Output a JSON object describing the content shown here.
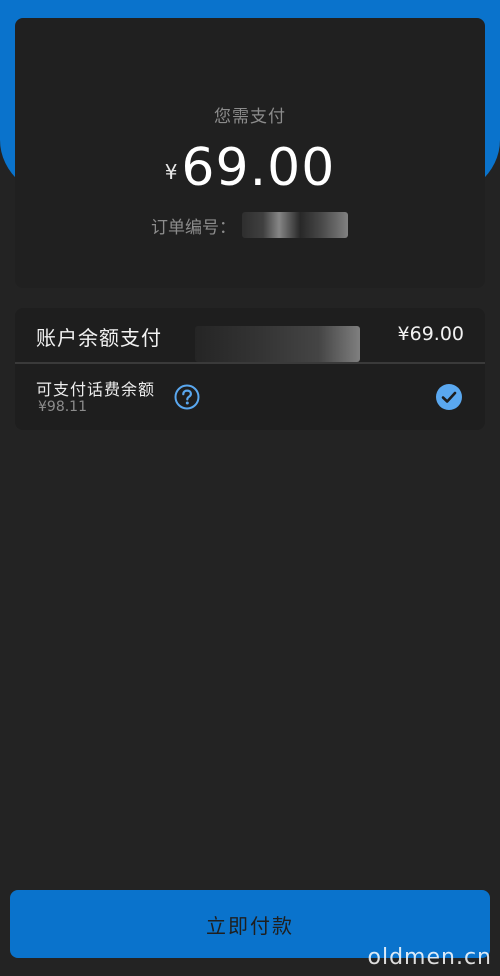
{
  "summary": {
    "pay_label": "您需支付",
    "currency_symbol": "¥",
    "amount": "69.00",
    "order_label": "订单编号："
  },
  "balance_payment": {
    "title": "账户余额支付",
    "amount": "¥69.00",
    "phone_balance_title": "可支付话费余额",
    "phone_balance_value": "¥98.11",
    "selected": true
  },
  "actions": {
    "pay_now_label": "立即付款"
  },
  "watermark": "oldmen.cn",
  "colors": {
    "accent_blue": "#0a73cc",
    "check_blue": "#5aa8f0",
    "background": "#232323",
    "card": "#202020"
  },
  "icons": {
    "help": "question-circle-icon",
    "check": "check-circle-icon"
  }
}
